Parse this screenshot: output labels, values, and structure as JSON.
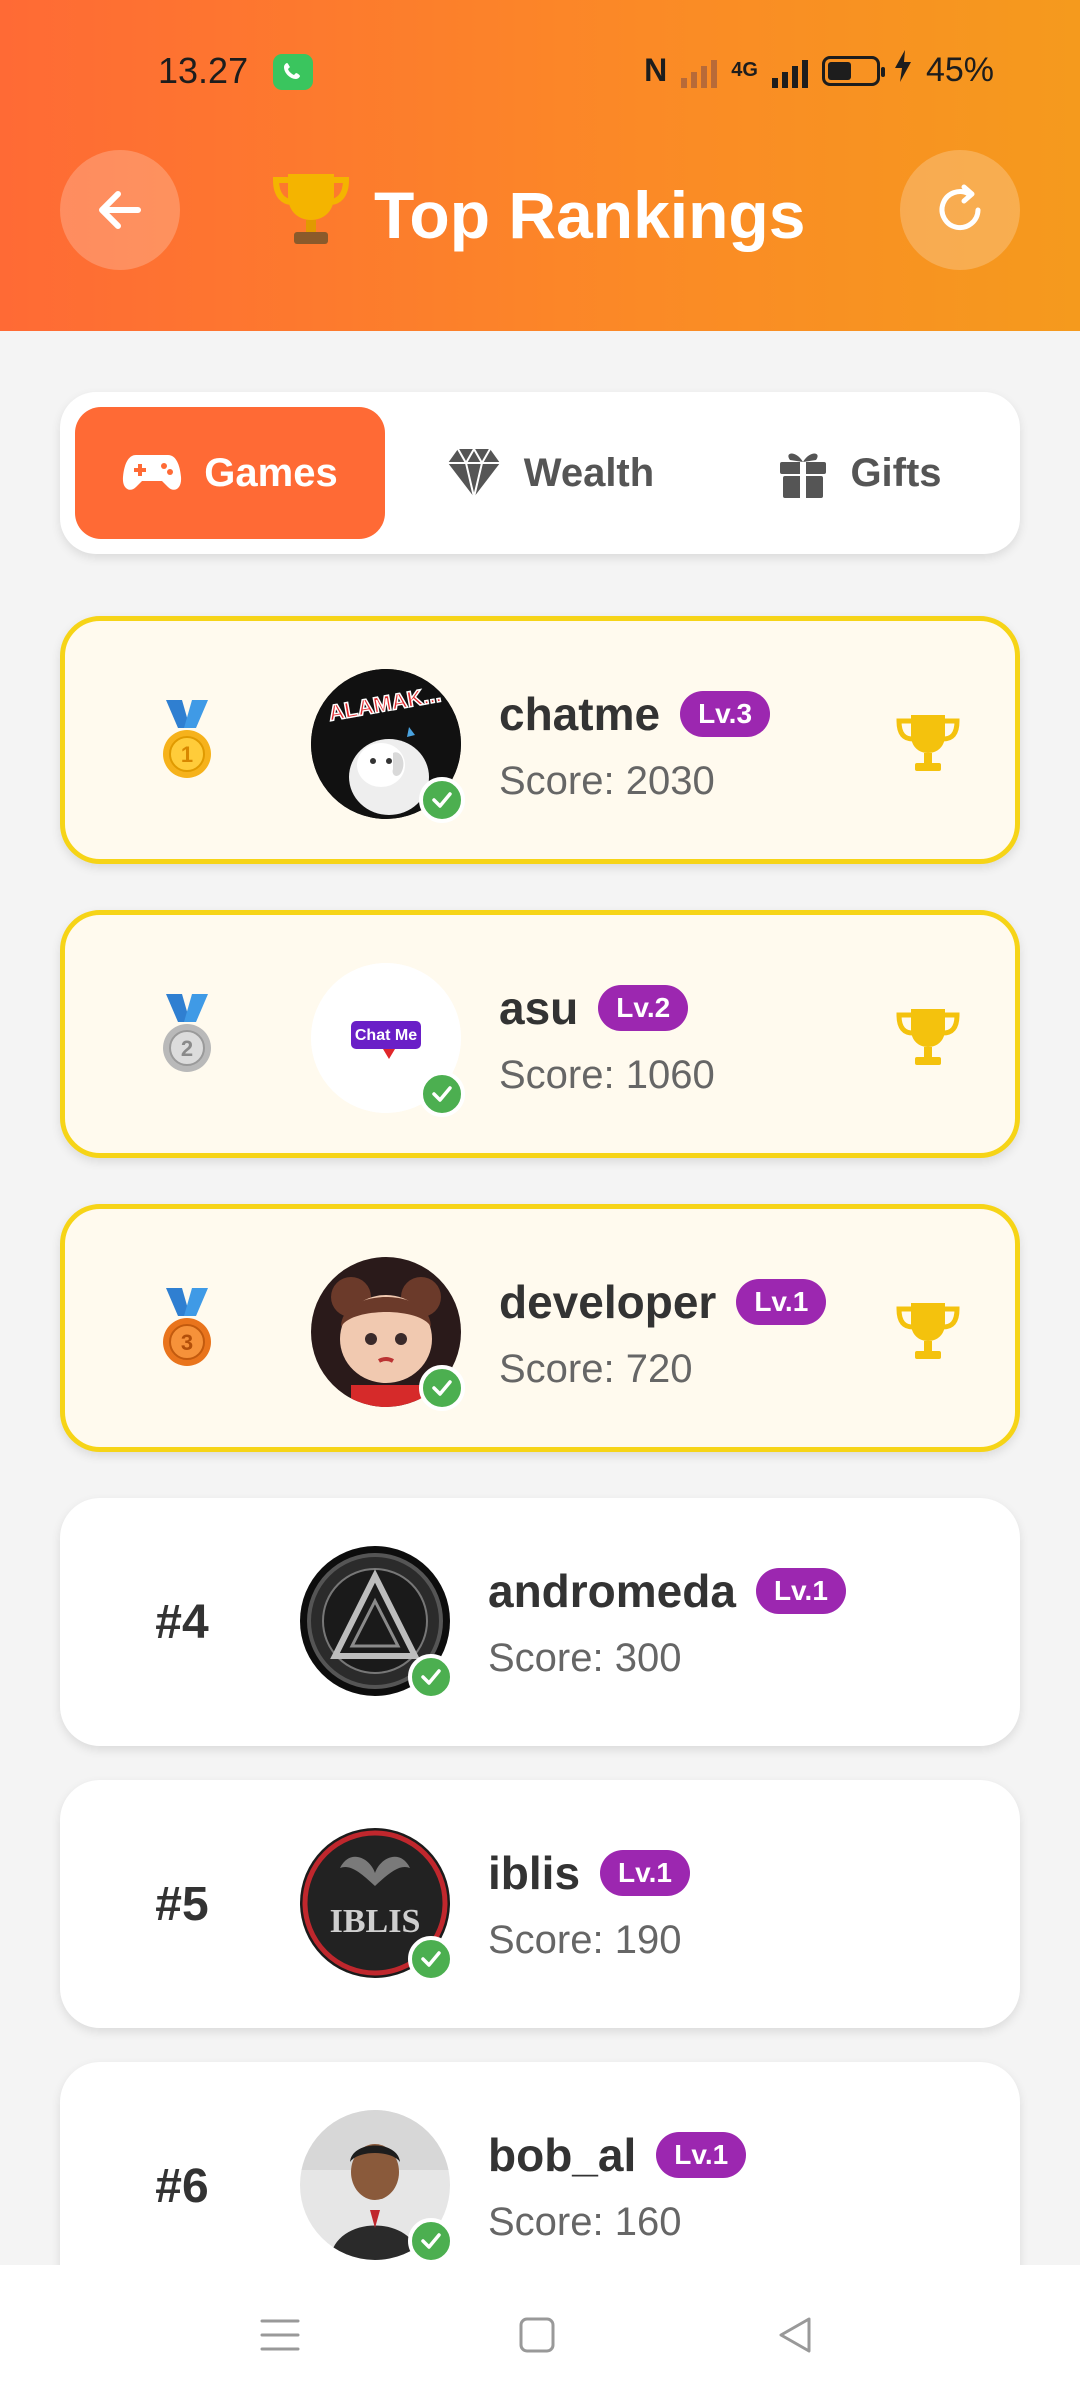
{
  "status_bar": {
    "time": "13.27",
    "battery": "45%",
    "network": "4G"
  },
  "header": {
    "title": "Top Rankings"
  },
  "tabs": [
    {
      "label": "Games",
      "active": true
    },
    {
      "label": "Wealth",
      "active": false
    },
    {
      "label": "Gifts",
      "active": false
    }
  ],
  "ranking": [
    {
      "rank": "1",
      "name": "chatme",
      "level": "Lv.3",
      "score": "Score: 2030",
      "avatar_text": "ALAMAK..."
    },
    {
      "rank": "2",
      "name": "asu",
      "level": "Lv.2",
      "score": "Score: 1060",
      "avatar_text": "Chat Me"
    },
    {
      "rank": "3",
      "name": "developer",
      "level": "Lv.1",
      "score": "Score: 720"
    },
    {
      "rank": "#4",
      "name": "andromeda",
      "level": "Lv.1",
      "score": "Score: 300"
    },
    {
      "rank": "#5",
      "name": "iblis",
      "level": "Lv.1",
      "score": "Score: 190",
      "avatar_text": "IBLIS"
    },
    {
      "rank": "#6",
      "name": "bob_al",
      "level": "Lv.1",
      "score": "Score: 160"
    }
  ],
  "colors": {
    "header_gradient_start": "#ff6a35",
    "header_gradient_end": "#f59a1d",
    "active_tab": "#ff6a35",
    "top3_border": "#f6d417",
    "level_badge": "#9c27b0",
    "verified": "#4caf50",
    "trophy": "#f4c20d"
  },
  "icons": [
    "back-arrow-icon",
    "refresh-icon",
    "trophy-icon",
    "gamepad-icon",
    "diamond-icon",
    "gift-icon",
    "medal-icon",
    "check-icon",
    "menu-icon",
    "home-icon",
    "back-nav-icon"
  ]
}
